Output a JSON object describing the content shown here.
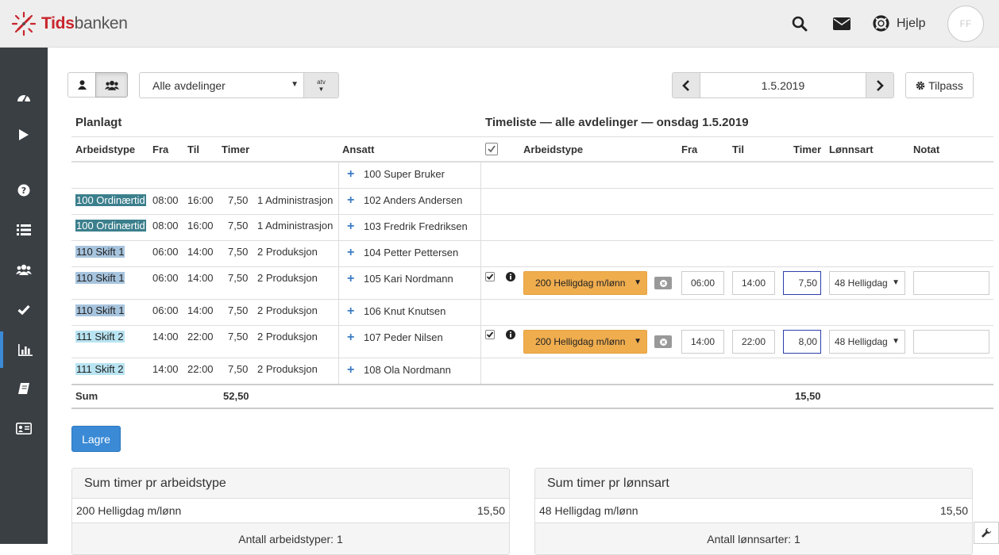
{
  "app": {
    "logo_part1": "Tids",
    "logo_part2": "banken",
    "help_label": "Hjelp",
    "avatar_initials": "FF"
  },
  "toolbar": {
    "department": "Alle avdelinger",
    "atv_label": "atv",
    "date": "1.5.2019",
    "customize_label": "Tilpass"
  },
  "planned": {
    "title": "Planlagt",
    "headers": {
      "worktype": "Arbeidstype",
      "from": "Fra",
      "to": "Til",
      "hours": "Timer",
      "employee": "Ansatt"
    },
    "rows": [
      {
        "worktype": "",
        "from": "",
        "to": "",
        "hours": "",
        "dept": "",
        "employee": "100 Super Bruker"
      },
      {
        "worktype": "100 Ordinærtid",
        "from": "08:00",
        "to": "16:00",
        "hours": "7,50",
        "dept": "1 Administrasjon",
        "employee": "102 Anders Andersen"
      },
      {
        "worktype": "100 Ordinærtid",
        "from": "08:00",
        "to": "16:00",
        "hours": "7,50",
        "dept": "1 Administrasjon",
        "employee": "103 Fredrik Fredriksen"
      },
      {
        "worktype": "110 Skift 1",
        "from": "06:00",
        "to": "14:00",
        "hours": "7,50",
        "dept": "2 Produksjon",
        "employee": "104 Petter Pettersen"
      },
      {
        "worktype": "110 Skift 1",
        "from": "06:00",
        "to": "14:00",
        "hours": "7,50",
        "dept": "2 Produksjon",
        "employee": "105 Kari Nordmann"
      },
      {
        "worktype": "110 Skift 1",
        "from": "06:00",
        "to": "14:00",
        "hours": "7,50",
        "dept": "2 Produksjon",
        "employee": "106 Knut Knutsen"
      },
      {
        "worktype": "111 Skift 2",
        "from": "14:00",
        "to": "22:00",
        "hours": "7,50",
        "dept": "2 Produksjon",
        "employee": "107 Peder Nilsen"
      },
      {
        "worktype": "111 Skift 2",
        "from": "14:00",
        "to": "22:00",
        "hours": "7,50",
        "dept": "2 Produksjon",
        "employee": "108 Ola Nordmann"
      }
    ],
    "sum_label": "Sum",
    "sum_hours": "52,50"
  },
  "timesheet": {
    "title": "Timeliste — alle avdelinger — onsdag 1.5.2019",
    "headers": {
      "worktype": "Arbeidstype",
      "from": "Fra",
      "to": "Til",
      "hours": "Timer",
      "wagetype": "Lønnsart",
      "note": "Notat"
    },
    "entries": [
      {
        "worktype": "200 Helligdag m/lønn",
        "from": "06:00",
        "to": "14:00",
        "hours": "7,50",
        "wagetype": "48 Helligdag",
        "note": ""
      },
      {
        "worktype": "200 Helligdag m/lønn",
        "from": "14:00",
        "to": "22:00",
        "hours": "8,00",
        "wagetype": "48 Helligdag",
        "note": ""
      }
    ],
    "sum_hours": "15,50"
  },
  "save_label": "Lagre",
  "summary_worktype": {
    "title": "Sum timer pr arbeidstype",
    "rows": [
      {
        "label": "200 Helligdag m/lønn",
        "value": "15,50"
      }
    ],
    "footer": "Antall arbeidstyper: 1"
  },
  "summary_wagetype": {
    "title": "Sum timer pr lønnsart",
    "rows": [
      {
        "label": "48 Helligdag m/lønn",
        "value": "15,50"
      }
    ],
    "footer": "Antall lønnsarter: 1"
  },
  "colors": {
    "ordinary_tag": "#3b7f8c",
    "shift1_tag": "#a7c4de",
    "shift2_tag": "#b9e4f2",
    "accent": "#3a8ad6",
    "warning": "#f0ad4e",
    "sidebar": "#3a3f44"
  }
}
